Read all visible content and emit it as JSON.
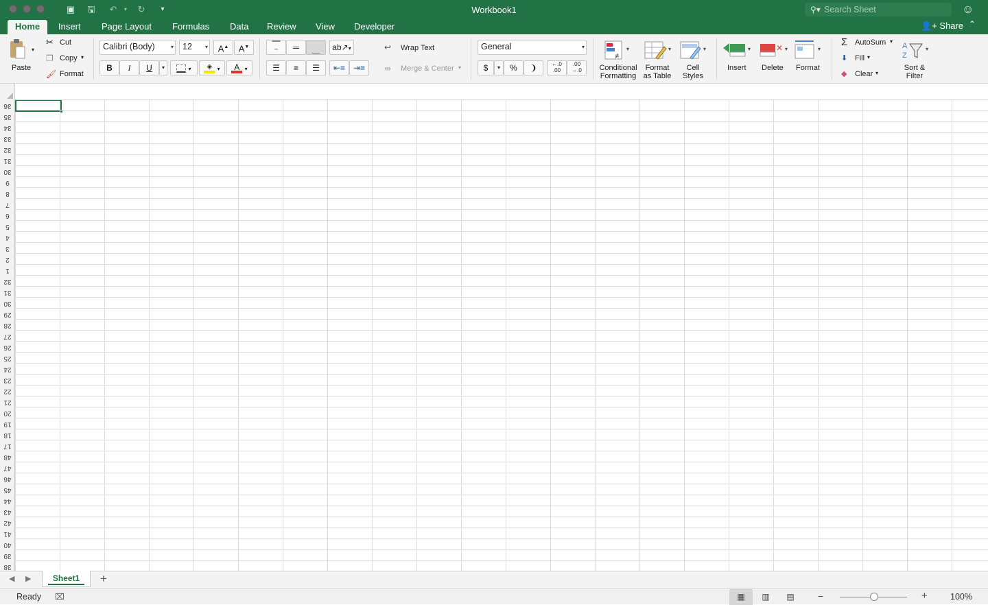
{
  "window": {
    "title": "Workbook1"
  },
  "search": {
    "placeholder": "Search Sheet"
  },
  "tabs": [
    "Home",
    "Insert",
    "Page Layout",
    "Formulas",
    "Data",
    "Review",
    "View",
    "Developer"
  ],
  "active_tab": "Home",
  "share_label": "Share",
  "clipboard": {
    "paste": "Paste",
    "cut": "Cut",
    "copy": "Copy",
    "format": "Format"
  },
  "font": {
    "name": "Calibri (Body)",
    "size": "12",
    "bold": "B",
    "italic": "I",
    "underline": "U"
  },
  "alignment": {
    "wrap_text": "Wrap Text",
    "merge_center": "Merge & Center"
  },
  "number": {
    "format": "General",
    "currency": "$",
    "percent": "%",
    "comma": "❩"
  },
  "styles": {
    "conditional_1": "Conditional",
    "conditional_2": "Formatting",
    "format_table_1": "Format",
    "format_table_2": "as Table",
    "cell_styles_1": "Cell",
    "cell_styles_2": "Styles"
  },
  "cells": {
    "insert": "Insert",
    "delete": "Delete",
    "format": "Format"
  },
  "editing": {
    "autosum": "AutoSum",
    "fill": "Fill",
    "clear": "Clear",
    "sort_1": "Sort &",
    "sort_2": "Filter"
  },
  "row_headers": [
    "36",
    "35",
    "34",
    "33",
    "32",
    "31",
    "30",
    "9",
    "8",
    "7",
    "6",
    "5",
    "4",
    "3",
    "2",
    "1",
    "32",
    "31",
    "30",
    "29",
    "28",
    "27",
    "26",
    "25",
    "24",
    "23",
    "22",
    "21",
    "20",
    "19",
    "18",
    "17",
    "48",
    "47",
    "46",
    "45",
    "44",
    "43",
    "42",
    "41",
    "40",
    "39",
    "38"
  ],
  "sheet_tabs": [
    "Sheet1"
  ],
  "add_sheet": "+",
  "status": {
    "ready": "Ready",
    "zoom": "100%"
  },
  "colors": {
    "brand": "#217346",
    "ribbon_bg": "#f3f3f3",
    "font_color_bar": "#e03030",
    "highlight_bar": "#f5e400"
  }
}
